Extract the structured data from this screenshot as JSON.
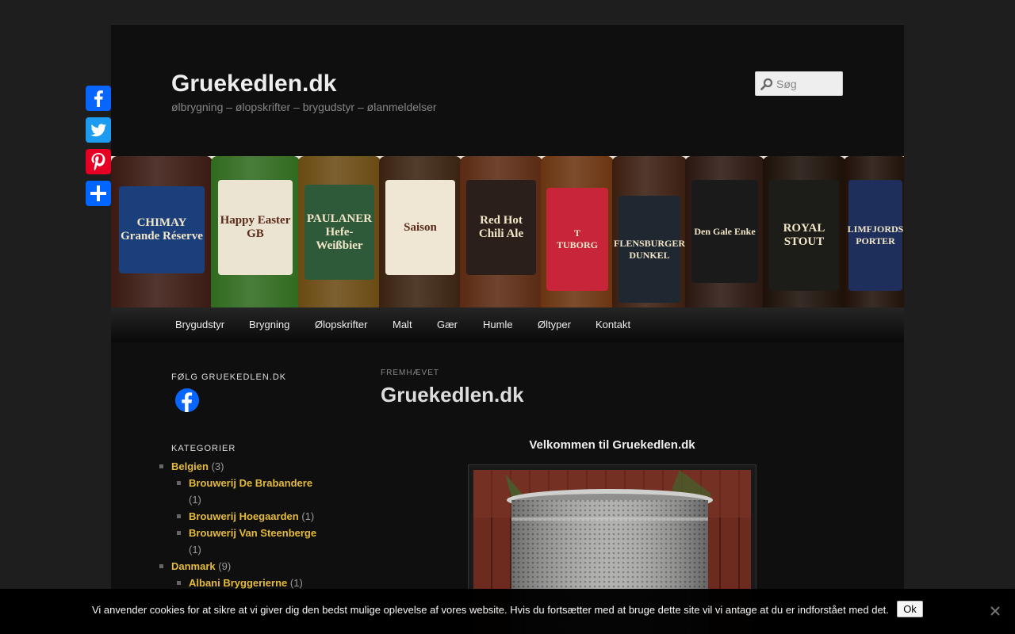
{
  "site": {
    "title": "Gruekedlen.dk",
    "description": "ølbrygning – ølopskrifter – brygudstyr – ølanmeldelser"
  },
  "search": {
    "placeholder": "Søg"
  },
  "banner": {
    "bottle_labels": [
      "CHIMAY\nGrande Réserve",
      "Happy Easter\nGB",
      "PAULANER\nHefe-Weißbier",
      "Saison",
      "Red Hot\nChili Ale",
      "T\nTUBORG",
      "FLENSBURGER\nDUNKEL",
      "Den Gale Enke",
      "ROYAL\nSTOUT",
      "LIMFJORDS\nPORTER"
    ]
  },
  "nav": {
    "items": [
      "Brygudstyr",
      "Brygning",
      "Ølopskrifter",
      "Malt",
      "Gær",
      "Humle",
      "Øltyper",
      "Kontakt"
    ]
  },
  "share_sidebar": {
    "buttons": [
      "Facebook",
      "Twitter",
      "Pinterest",
      "Share"
    ],
    "colors": [
      "#0866ff",
      "#1d9bf0",
      "#e60023",
      "#0166ff"
    ]
  },
  "widgets": {
    "follow_title": "FØLG GRUEKEDLEN.DK",
    "categories_title": "KATEGORIER",
    "categories": [
      {
        "level": 0,
        "name": "Belgien",
        "count": "(3)"
      },
      {
        "level": 1,
        "name": "Brouwerij De Brabandere",
        "count": "(1)"
      },
      {
        "level": 1,
        "name": "Brouwerij Hoegaarden",
        "count": "(1)"
      },
      {
        "level": 1,
        "name": "Brouwerij Van Steenberge",
        "count": "(1)"
      },
      {
        "level": 0,
        "name": "Danmark",
        "count": "(9)"
      },
      {
        "level": 1,
        "name": "Albani Bryggerierne",
        "count": "(1)"
      }
    ]
  },
  "main": {
    "featured_label": "FREMHÆVET",
    "entry_title": "Gruekedlen.dk",
    "welcome_heading": "Velkommen til Gruekedlen.dk"
  },
  "cookie": {
    "text": "Vi anvender cookies for at sikre at vi giver dig den bedst mulige oplevelse af vores website. Hvis du fortsætter med at bruge dette site vil vi antage at du er indforstået med det.",
    "ok_label": "Ok"
  },
  "colors": {
    "link": "#e4bb3b",
    "page_bg": "#0f0f0f",
    "body_bg": "#1e1e1e"
  }
}
